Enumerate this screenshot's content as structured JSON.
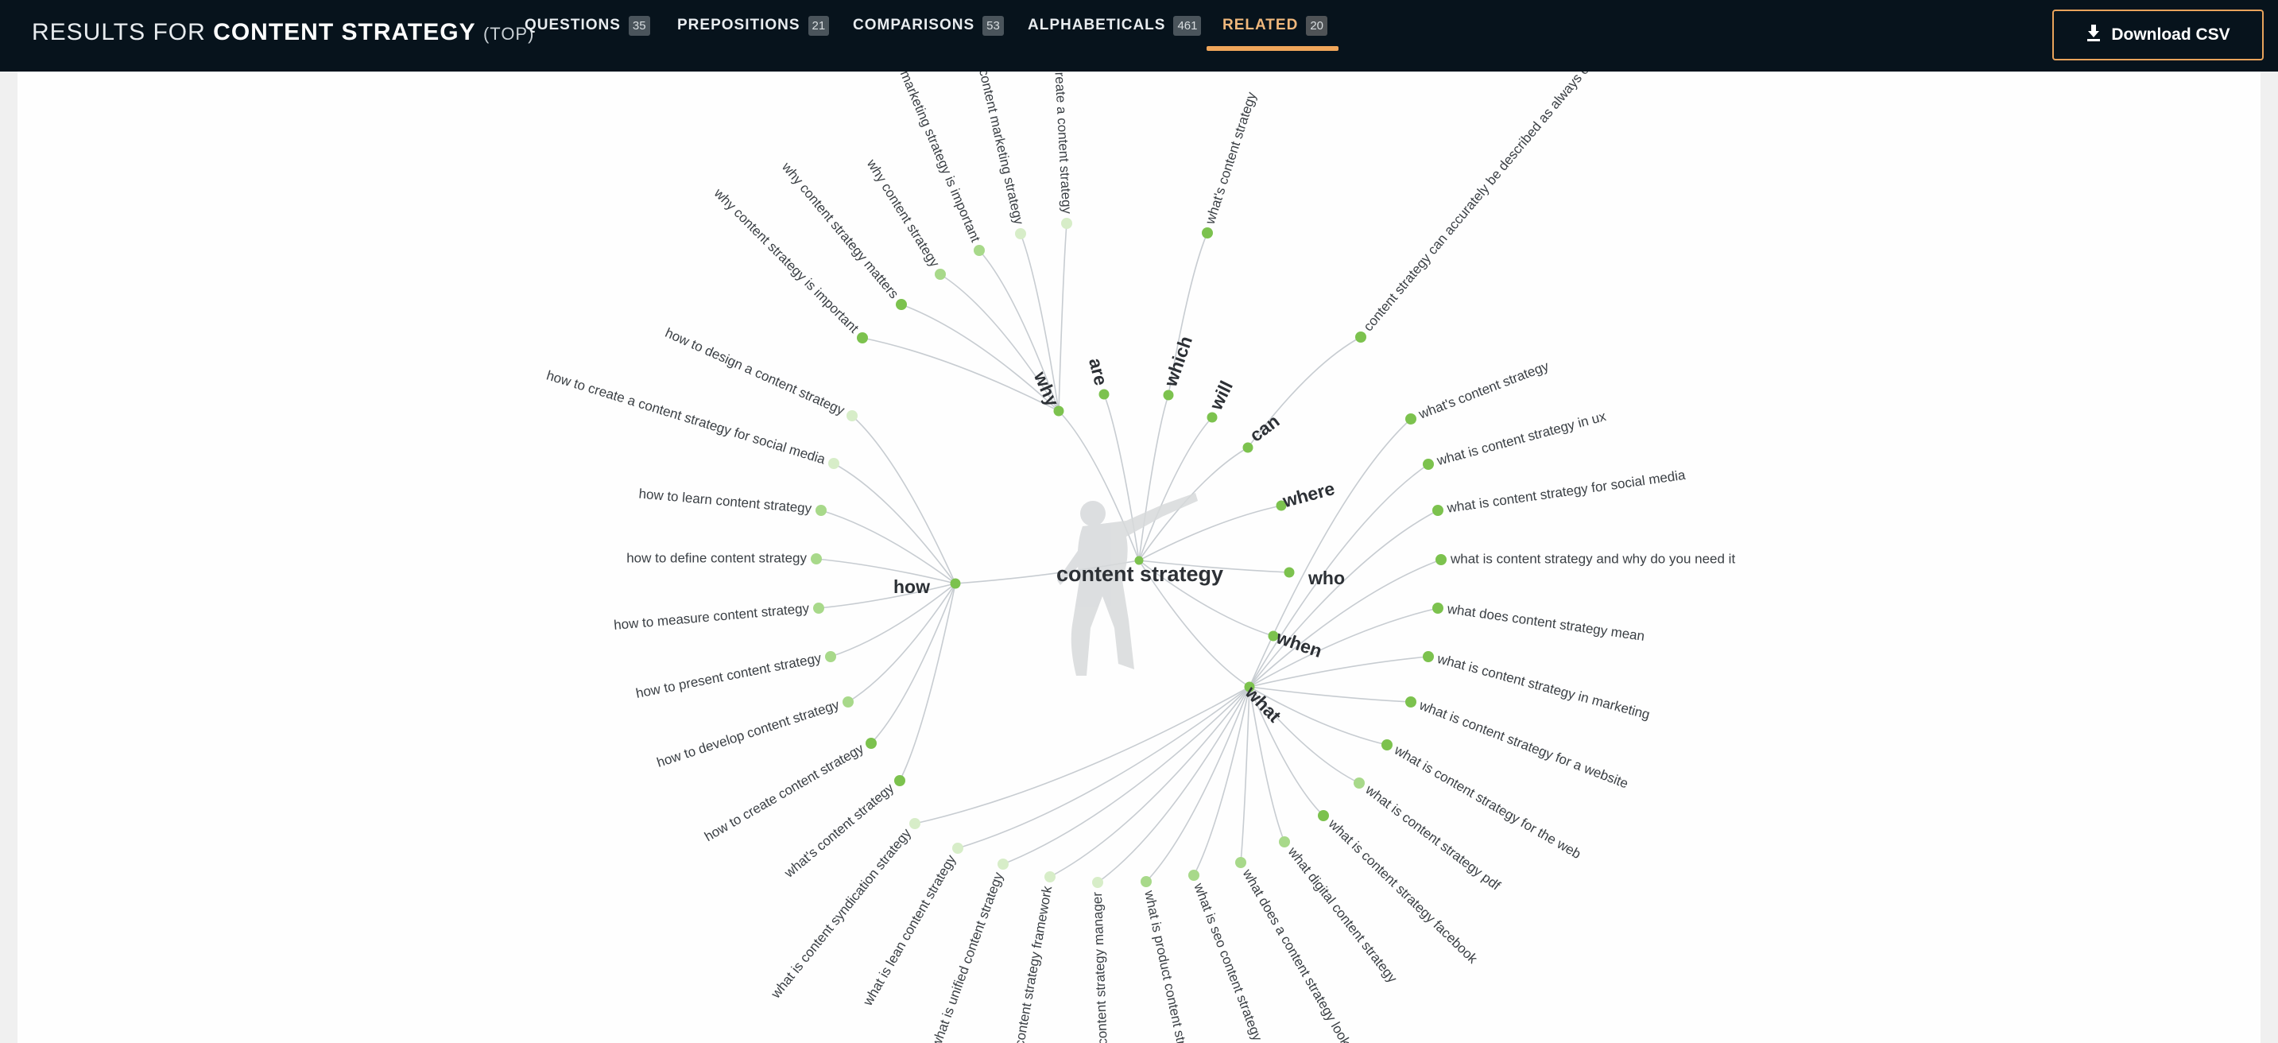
{
  "header": {
    "prefix": "RESULTS FOR",
    "keyword": "CONTENT STRATEGY",
    "mode": "(TOP)",
    "download_label": "Download CSV"
  },
  "tabs": [
    {
      "label": "QUESTIONS",
      "count": "35",
      "active": false
    },
    {
      "label": "PREPOSITIONS",
      "count": "21",
      "active": false
    },
    {
      "label": "COMPARISONS",
      "count": "53",
      "active": false
    },
    {
      "label": "ALPHABETICALS",
      "count": "461",
      "active": false
    },
    {
      "label": "RELATED",
      "count": "20",
      "active": true
    }
  ],
  "colors": {
    "accent": "#f0a65a",
    "topbar": "#07131c",
    "node_strong": "#7cc24e",
    "node_mid": "#a8d98a",
    "node_faint": "#d7edc8",
    "link": "#c7ccd1"
  },
  "wheel": {
    "root": "content strategy",
    "branches": [
      {
        "label": "why",
        "leaves": [
          {
            "text": "why content strategy is important",
            "strength": 3
          },
          {
            "text": "why content strategy matters",
            "strength": 3
          },
          {
            "text": "why content strategy",
            "strength": 2
          },
          {
            "text": "why content marketing strategy is important",
            "strength": 2
          },
          {
            "text": "why content marketing strategy",
            "strength": 1
          },
          {
            "text": "why create a content strategy",
            "strength": 1
          }
        ]
      },
      {
        "label": "are",
        "leaves": []
      },
      {
        "label": "which",
        "leaves": [
          {
            "text": "what's content strategy",
            "strength": 3
          }
        ]
      },
      {
        "label": "will",
        "leaves": []
      },
      {
        "label": "can",
        "leaves": [
          {
            "text": "content strategy can accurately be described as always on",
            "strength": 3
          }
        ]
      },
      {
        "label": "where",
        "leaves": []
      },
      {
        "label": "who",
        "leaves": []
      },
      {
        "label": "when",
        "leaves": []
      },
      {
        "label": "what",
        "leaves": [
          {
            "text": "what's content strategy",
            "strength": 3
          },
          {
            "text": "what is content strategy in ux",
            "strength": 3
          },
          {
            "text": "what is content strategy for social media",
            "strength": 3
          },
          {
            "text": "what is content strategy and why do you need it",
            "strength": 3
          },
          {
            "text": "what does content strategy mean",
            "strength": 3
          },
          {
            "text": "what is content strategy in marketing",
            "strength": 3
          },
          {
            "text": "what is content strategy for a website",
            "strength": 3
          },
          {
            "text": "what is content strategy for the web",
            "strength": 3
          },
          {
            "text": "what is content strategy pdf",
            "strength": 2
          },
          {
            "text": "what is content strategy facebook",
            "strength": 3
          },
          {
            "text": "what digital content strategy",
            "strength": 2
          },
          {
            "text": "what does a content strategy look like",
            "strength": 2
          },
          {
            "text": "what is seo content strategy",
            "strength": 2
          },
          {
            "text": "what is product content strategy",
            "strength": 2
          },
          {
            "text": "what is content strategy manager",
            "strength": 1
          },
          {
            "text": "what is content strategy framework",
            "strength": 1
          },
          {
            "text": "what is unified content strategy",
            "strength": 1
          },
          {
            "text": "what is lean content strategy",
            "strength": 1
          },
          {
            "text": "what is content syndication strategy",
            "strength": 1
          }
        ]
      },
      {
        "label": "how",
        "leaves": [
          {
            "text": "how to design a content strategy",
            "strength": 1
          },
          {
            "text": "how to create a content strategy for social media",
            "strength": 1
          },
          {
            "text": "how to learn content strategy",
            "strength": 2
          },
          {
            "text": "how to define content strategy",
            "strength": 2
          },
          {
            "text": "how to measure content strategy",
            "strength": 2
          },
          {
            "text": "how to present content strategy",
            "strength": 2
          },
          {
            "text": "how to develop content strategy",
            "strength": 2
          },
          {
            "text": "how to create content strategy",
            "strength": 3
          },
          {
            "text": "what's content strategy",
            "strength": 3
          }
        ]
      }
    ]
  }
}
